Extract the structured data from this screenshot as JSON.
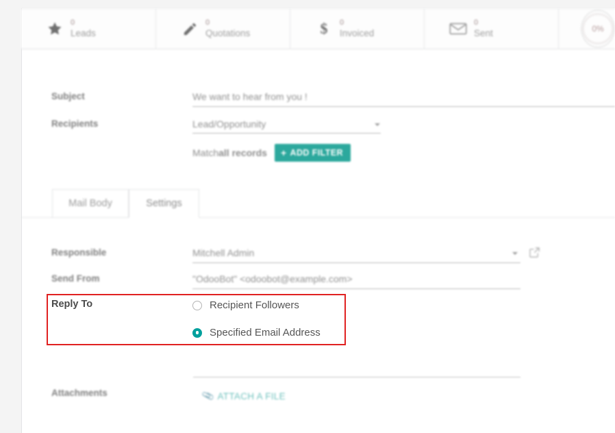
{
  "stats": [
    {
      "count": "0",
      "label": "Leads",
      "icon": "star-icon"
    },
    {
      "count": "0",
      "label": "Quotations",
      "icon": "pencil-icon"
    },
    {
      "count": "0",
      "label": "Invoiced",
      "icon": "dollar-icon"
    },
    {
      "count": "0",
      "label": "Sent",
      "icon": "envelope-icon"
    }
  ],
  "gauge": {
    "value": "0%"
  },
  "form": {
    "subject": {
      "label": "Subject",
      "value": "We want to hear from you !"
    },
    "recipients": {
      "label": "Recipients",
      "value": "Lead/Opportunity"
    },
    "match": {
      "prefix": "Match ",
      "strong": "all records",
      "add_filter_label": "ADD FILTER",
      "plus": "+"
    },
    "responsible": {
      "label": "Responsible",
      "value": "Mitchell Admin"
    },
    "send_from": {
      "label": "Send From",
      "value": "\"OdooBot\" <odoobot@example.com>"
    },
    "reply_to": {
      "label": "Reply To",
      "options": [
        {
          "text": "Recipient Followers",
          "selected": false
        },
        {
          "text": "Specified Email Address",
          "selected": true
        }
      ]
    },
    "attachments": {
      "label": "Attachments",
      "action_label": "ATTACH A FILE"
    }
  },
  "tabs": [
    {
      "label": "Mail Body",
      "active": false
    },
    {
      "label": "Settings",
      "active": true
    }
  ],
  "colors": {
    "accent_teal": "#26a69a",
    "radio_teal": "#00a09d",
    "highlight_red": "#e02020",
    "link_teal": "#6ec1bd"
  }
}
